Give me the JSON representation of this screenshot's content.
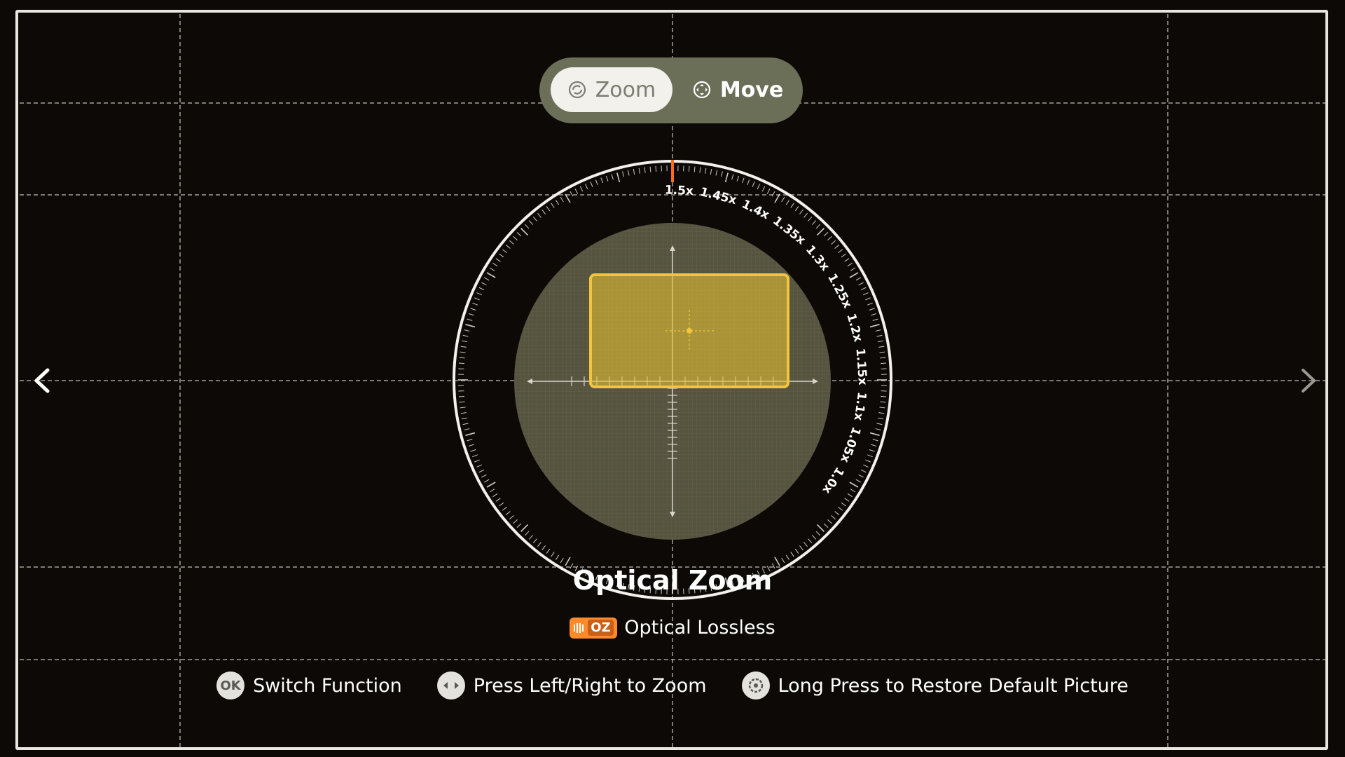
{
  "mode_switch": {
    "zoom_label": "Zoom",
    "move_label": "Move",
    "selected": "Zoom"
  },
  "dial": {
    "scale_labels": [
      "1.5x",
      "1.45x",
      "1.4x",
      "1.35x",
      "1.3x",
      "1.25x",
      "1.2x",
      "1.15x",
      "1.1x",
      "1.05x",
      "1.0x"
    ],
    "current_zoom": "1.5x"
  },
  "title": "Optical Zoom",
  "badge": {
    "icon_text": "OZ",
    "label": "Optical Lossless"
  },
  "hints": [
    {
      "icon_text": "OK",
      "label": "Switch Function"
    },
    {
      "icon_text": "",
      "label": "Press Left/Right to Zoom"
    },
    {
      "icon_text": "",
      "label": "Long Press to Restore Default Picture"
    }
  ],
  "colors": {
    "accent": "#ff6a1a",
    "frame_yellow": "#f2c53c",
    "pill": "#6b6f58"
  }
}
